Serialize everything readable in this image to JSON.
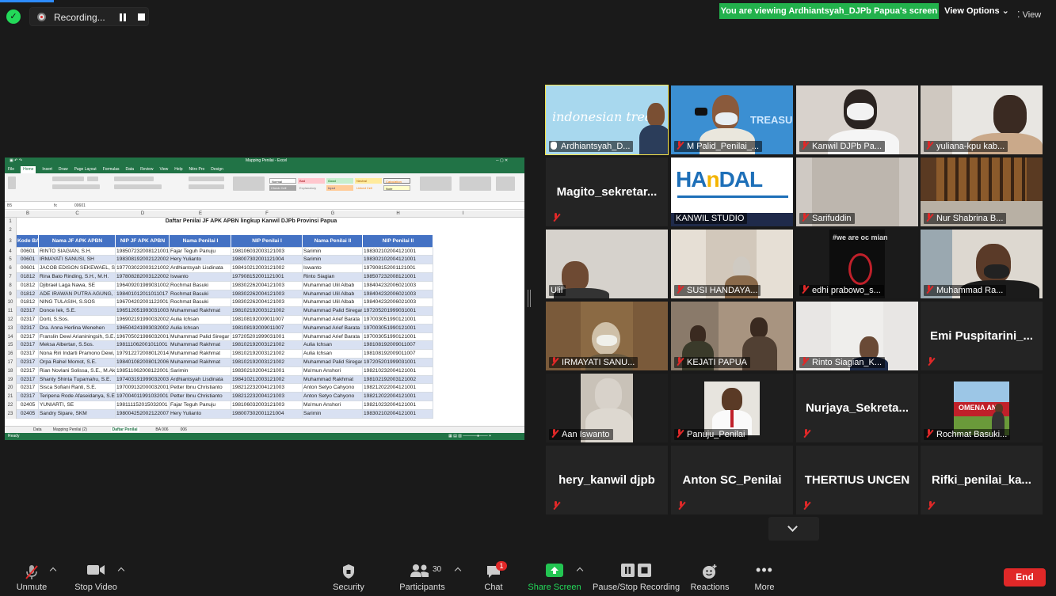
{
  "top_bar": {
    "recording_label": "Recording...",
    "viewing_banner": "You are viewing Ardhiantsyah_DJPb Papua's screen",
    "view_options": "View Options",
    "view_label": "View"
  },
  "spreadsheet": {
    "tabs": [
      "File",
      "Home",
      "Insert",
      "Draw",
      "Page Layout",
      "Formulas",
      "Data",
      "Review",
      "View",
      "Help",
      "Nitro Pro",
      "Design"
    ],
    "cell_ref": "B5",
    "formula_value": "00601",
    "col_letters": [
      "B",
      "C",
      "D",
      "E",
      "F",
      "G",
      "H",
      "I"
    ],
    "title": "Daftar Penilai JF APK APBN lingkup Kanwil DJPb Provinsi Papua",
    "headers": [
      "Kode BA/ES1",
      "Nama JF APK APBN",
      "NIP JF APK APBN",
      "Nama Penilai I",
      "NIP Penilai I",
      "Nama Penilai II",
      "NIP Penilai II"
    ],
    "rows": [
      {
        "n": "4",
        "kode": "00601",
        "nama": "RINTO SIAGIAN, S.H.",
        "nip": "198507232008121001",
        "p1": "Fajar Teguh Panuju",
        "nip1": "198106032003121003",
        "p2": "Sarimin",
        "nip2": "198302102004121001"
      },
      {
        "n": "5",
        "kode": "00601",
        "nama": "IRMAYATI SANUSI, SH",
        "nip": "198308192002122002",
        "p1": "Hery Yulianto",
        "nip1": "198007302001121004",
        "p2": "Sarimin",
        "nip2": "198302102004121001"
      },
      {
        "n": "6",
        "kode": "00601",
        "nama": "JACOB EDISON SEKEWAEL, S.H.",
        "nip": "197703022003121002",
        "p1": "Ardhiantsyah Lisdinata",
        "nip1": "198410212003121002",
        "p2": "Iswanto",
        "nip2": "197908152001121001"
      },
      {
        "n": "7",
        "kode": "01812",
        "nama": "Rina Bato Rinding, S.H., M.H.",
        "nip": "197808282003122002",
        "p1": "Iswanto",
        "nip1": "197908152001121001",
        "p2": "Rinto Siagian",
        "nip2": "198507232008121001"
      },
      {
        "n": "8",
        "kode": "01812",
        "nama": "Djibrael Laga Nawa, SE",
        "nip": "196409201989031002",
        "p1": "Rochmat Basuki",
        "nip1": "198302262004121003",
        "p2": "Muhammad Ulil Albab",
        "nip2": "198404232006021003"
      },
      {
        "n": "9",
        "kode": "01812",
        "nama": "ADE IRAWAN PUTRA AGUNG, S.P., M.P.",
        "nip": "198401012011011017",
        "p1": "Rochmat Basuki",
        "nip1": "198302262004121003",
        "p2": "Muhammad Ulil Albab",
        "nip2": "198404232006021003"
      },
      {
        "n": "10",
        "kode": "01812",
        "nama": "NING TULASIH, S.SOS",
        "nip": "196704202001122001",
        "p1": "Rochmat Basuki",
        "nip1": "198302262004121003",
        "p2": "Muhammad Ulil Albab",
        "nip2": "198404232006021003"
      },
      {
        "n": "11",
        "kode": "02317",
        "nama": "Donce Iek, S.E.",
        "nip": "196512051993031003",
        "p1": "Muhammad Rakhmat",
        "nip1": "198102192003121002",
        "p2": "Muhammad Palid Siregar",
        "nip2": "197205201999031001"
      },
      {
        "n": "12",
        "kode": "02317",
        "nama": "Dorti, S.Sos.",
        "nip": "196902191990032002",
        "p1": "Aulia Ichsan",
        "nip1": "198108192009011007",
        "p2": "Muhammad Arief Barata",
        "nip2": "197003051990121001"
      },
      {
        "n": "13",
        "kode": "02317",
        "nama": "Dra. Anna Herlina Wenehen",
        "nip": "196504241993032002",
        "p1": "Aulia Ichsan",
        "nip1": "198108192009011007",
        "p2": "Muhammad Arief Barata",
        "nip2": "197003051990121001"
      },
      {
        "n": "14",
        "kode": "02317",
        "nama": "Franslin Dewi Arianiningsih, S.E., M.Si.",
        "nip": "196705021986032001",
        "p1": "Muhammad Palid Siregar",
        "nip1": "197205201999031001",
        "p2": "Muhammad Arief Barata",
        "nip2": "197003051990121001"
      },
      {
        "n": "15",
        "kode": "02317",
        "nama": "Meksa Albertan, S.Sos.",
        "nip": "198111062001011001",
        "p1": "Muhammad Rakhmat",
        "nip1": "198102192003121002",
        "p2": "Aulia Ichsan",
        "nip2": "198108192009011007"
      },
      {
        "n": "16",
        "kode": "02317",
        "nama": "Nona Riri Indarti Pramono Dewi, S.E.",
        "nip": "197912272008012014",
        "p1": "Muhammad Rakhmat",
        "nip1": "198102192003121002",
        "p2": "Aulia Ichsan",
        "nip2": "198108192009011007"
      },
      {
        "n": "17",
        "kode": "02317",
        "nama": "Orpa Rahel Momot, S.E.",
        "nip": "198401082008012006",
        "p1": "Muhammad Rakhmat",
        "nip1": "198102192003121002",
        "p2": "Muhammad Palid Siregar",
        "nip2": "197205201999031001"
      },
      {
        "n": "18",
        "kode": "02317",
        "nama": "Rian Novlani Solissa, S.E., M.Ak.",
        "nip": "198511062008122001",
        "p1": "Sarimin",
        "nip1": "198302102004121001",
        "p2": "Ma'mun Anshori",
        "nip2": "198210232004121001"
      },
      {
        "n": "19",
        "kode": "02317",
        "nama": "Shanty Shinta Tupamahu, S.E.",
        "nip": "197403191999032003",
        "p1": "Ardhiantsyah Lisdinata",
        "nip1": "198410212003121002",
        "p2": "Muhammad Rakhmat",
        "nip2": "198102192003121002"
      },
      {
        "n": "20",
        "kode": "02317",
        "nama": "Sisca Sofiani Ranti, S.E.",
        "nip": "197009132000032001",
        "p1": "Petter Ibnu Christianto",
        "nip1": "198212232004121003",
        "p2": "Anton Setyo Cahyono",
        "nip2": "198212022004121001"
      },
      {
        "n": "21",
        "kode": "02317",
        "nama": "Teripena Rode Afaseidanya, S.E.",
        "nip": "197004011991032001",
        "p1": "Petter Ibnu Christianto",
        "nip1": "198212232004121003",
        "p2": "Anton Setyo Cahyono",
        "nip2": "198212022004121001"
      },
      {
        "n": "22",
        "kode": "02405",
        "nama": "YUNIARTI, SE",
        "nip": "198111152015032001",
        "p1": "Fajar Teguh Panuju",
        "nip1": "198106032003121003",
        "p2": "Ma'mun Anshori",
        "nip2": "198210232004121001"
      },
      {
        "n": "23",
        "kode": "02405",
        "nama": "Sandry Sipare, SKM",
        "nip": "198004252002122007",
        "p1": "Hery Yulianto",
        "nip1": "198007302001121004",
        "p2": "Sarimin",
        "nip2": "198302102004121001"
      }
    ],
    "sheet_tabs": [
      "Data",
      "Mapping Penilai (2)",
      "Daftar Penilai",
      "BA 006",
      "006"
    ],
    "status": "Ready"
  },
  "participants": [
    {
      "name": "Ardhiantsyah_D...",
      "style": "video",
      "muted": false
    },
    {
      "name": "M Palid_Penilai_...",
      "style": "video",
      "muted": true
    },
    {
      "name": "Kanwil DJPb Pa...",
      "style": "video",
      "muted": true
    },
    {
      "name": "yuliana-kpu kab...",
      "style": "video",
      "muted": true
    },
    {
      "name": "Magito_sekretar...",
      "style": "text",
      "muted": true
    },
    {
      "name": "KANWIL STUDIO",
      "style": "video",
      "muted": false,
      "logo": "HAnDAL"
    },
    {
      "name": "Sarifuddin",
      "style": "video",
      "muted": true
    },
    {
      "name": "Nur Shabrina B...",
      "style": "video",
      "muted": true
    },
    {
      "name": "Ulil",
      "style": "video",
      "muted": false
    },
    {
      "name": "SUSI HANDAYA...",
      "style": "video",
      "muted": true
    },
    {
      "name": "edhi prabowo_s...",
      "style": "video",
      "muted": true,
      "poster": "#we are oc mian"
    },
    {
      "name": "Muhammad Ra...",
      "style": "video",
      "muted": true
    },
    {
      "name": "IRMAYATI SANU...",
      "style": "video",
      "muted": true
    },
    {
      "name": "KEJATI PAPUA",
      "style": "video",
      "muted": true
    },
    {
      "name": "Rinto Siagian_K...",
      "style": "video",
      "muted": true
    },
    {
      "name": "Emi  Puspitarini_...",
      "style": "text",
      "muted": true
    },
    {
      "name": "Aan Iswanto",
      "style": "video",
      "muted": true
    },
    {
      "name": "Panuju_Penilai",
      "style": "video",
      "muted": true
    },
    {
      "name": "Nurjaya_Sekreta...",
      "style": "text",
      "muted": true
    },
    {
      "name": "Rochmat Basuki...",
      "style": "video",
      "muted": true
    },
    {
      "name": "hery_kanwil djpb",
      "style": "text",
      "muted": true
    },
    {
      "name": "Anton SC_Penilai",
      "style": "text",
      "muted": true
    },
    {
      "name": "THERTIUS UNCEN",
      "style": "text",
      "muted": true
    },
    {
      "name": "Rifki_penilai_ka...",
      "style": "text",
      "muted": true
    }
  ],
  "toolbar": {
    "unmute": "Unmute",
    "stop_video": "Stop Video",
    "security": "Security",
    "participants": "Participants",
    "participants_count": "30",
    "chat": "Chat",
    "chat_badge": "1",
    "share_screen": "Share Screen",
    "pause_stop_recording": "Pause/Stop Recording",
    "reactions": "Reactions",
    "more": "More",
    "end": "End"
  },
  "colors": {
    "share_green": "#22b14c",
    "end_red": "#e02828",
    "speaker_outline": "#f4e24a",
    "excel_green": "#217346"
  }
}
